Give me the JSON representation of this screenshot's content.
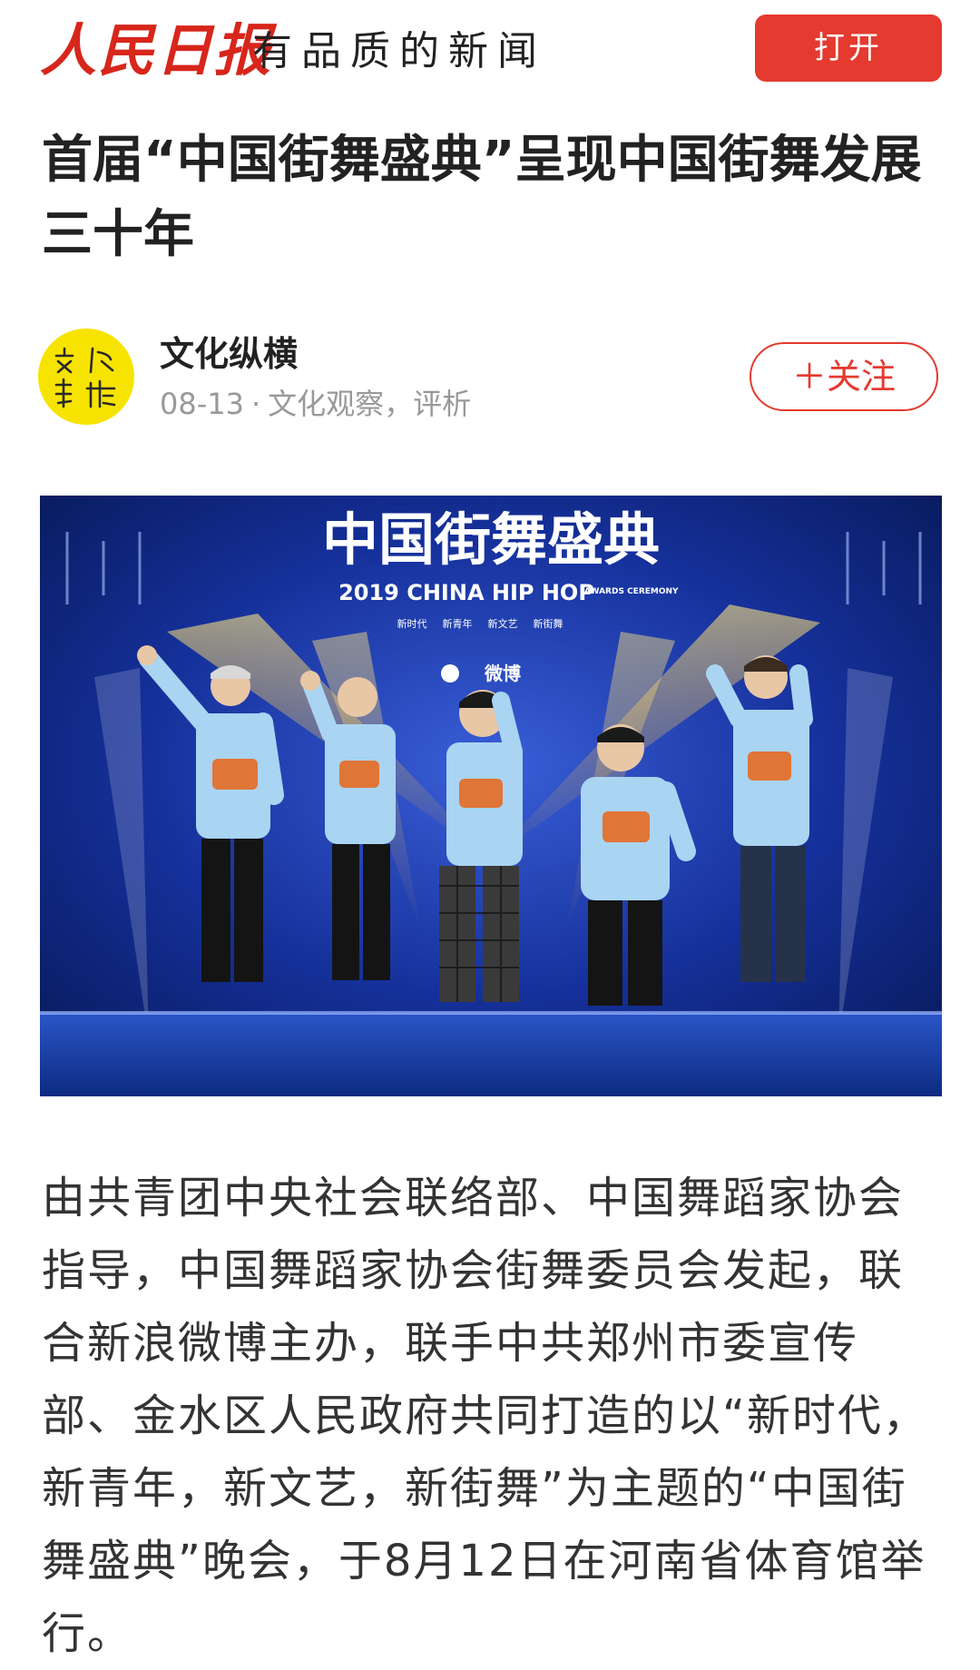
{
  "header": {
    "logo_text": "人民日报",
    "slogan": "有品质的新闻",
    "open_button": "打开"
  },
  "article": {
    "title": "首届“中国街舞盛典”呈现中国街舞发展三十年",
    "author": {
      "name": "文化纵横",
      "avatar_text": "文化纵横",
      "date": "08-13",
      "separator": "·",
      "category": "文化观察，评析",
      "follow_button": "＋关注"
    },
    "hero_image": {
      "banner_title": "中国街舞盛典",
      "banner_subtitle": "2019 CHINA HIP HOP",
      "banner_awards": "AWARDS CEREMONY",
      "banner_tags": [
        "新时代",
        "新青年",
        "新文艺",
        "新街舞"
      ],
      "banner_partner": "微博"
    },
    "body": "由共青团中央社会联络部、中国舞蹈家协会指导，中国舞蹈家协会街舞委员会发起，联合新浪微博主办，联手中共郑州市委宣传部、金水区人民政府共同打造的以“新时代，新青年，新文艺，新街舞”为主题的“中国街舞盛典”晚会，于8月12日在河南省体育馆举行。"
  },
  "colors": {
    "brand_red": "#d7261b",
    "button_red": "#e43a2f",
    "meta_gray": "#999999",
    "avatar_yellow": "#f7e300"
  }
}
